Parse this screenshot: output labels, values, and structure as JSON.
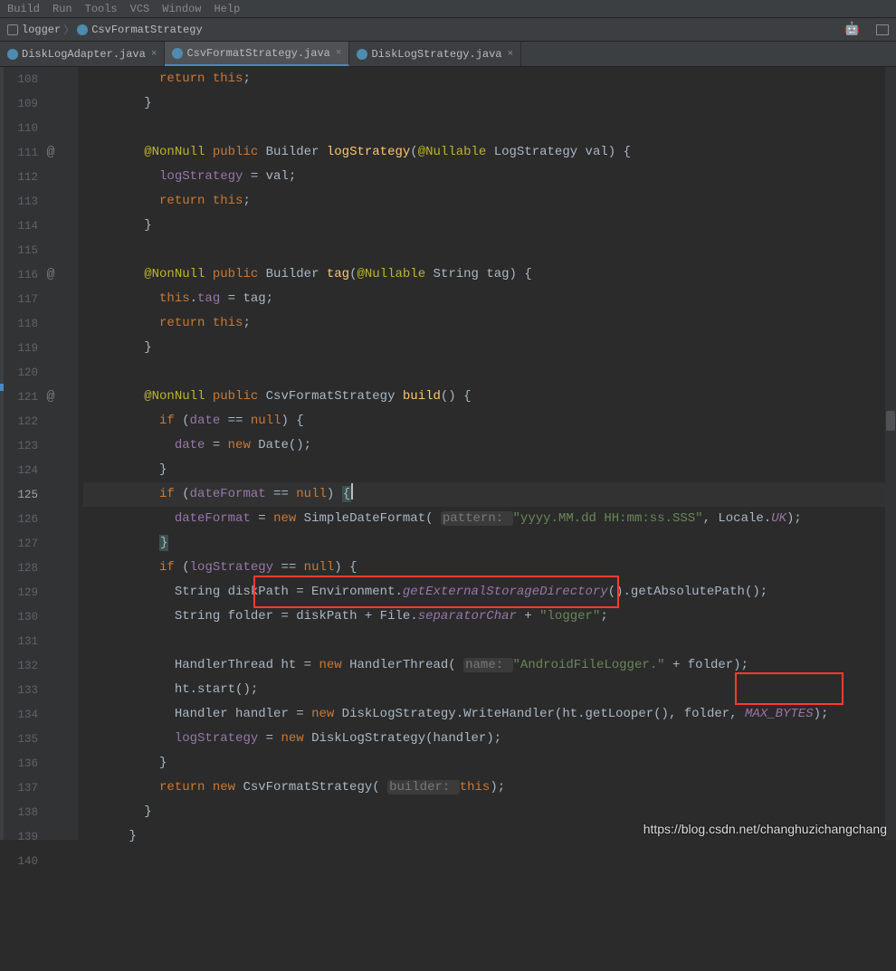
{
  "menubar": [
    "Build",
    "Run",
    "Tools",
    "VCS",
    "Window",
    "Help"
  ],
  "breadcrumb": {
    "module": "logger",
    "class": "CsvFormatStrategy"
  },
  "tabs": [
    {
      "label": "DiskLogAdapter.java",
      "active": false
    },
    {
      "label": "CsvFormatStrategy.java",
      "active": true
    },
    {
      "label": "DiskLogStrategy.java",
      "active": false
    }
  ],
  "gutter": {
    "start": 108,
    "end": 140,
    "current": 125,
    "annotation_markers": [
      111,
      116,
      121
    ]
  },
  "code": {
    "l108": {
      "indent": "          ",
      "t1": "return ",
      "t2": "this",
      "t3": ";"
    },
    "l109": {
      "indent": "        ",
      "brace": "}"
    },
    "l110": "",
    "l111": {
      "indent": "        ",
      "an": "@NonNull ",
      "kw1": "public ",
      "type": "Builder ",
      "mname": "logStrategy",
      "paren1": "(",
      "an2": "@Nullable ",
      "ptype": "LogStrategy ",
      "pname": "val",
      "paren2": ") {"
    },
    "l112": {
      "indent": "          ",
      "fld": "logStrategy",
      "rest": " = val;"
    },
    "l113": {
      "indent": "          ",
      "kw": "return ",
      "kw2": "this",
      "semi": ";"
    },
    "l114": {
      "indent": "        ",
      "brace": "}"
    },
    "l115": "",
    "l116": {
      "indent": "        ",
      "an": "@NonNull ",
      "kw1": "public ",
      "type": "Builder ",
      "mname": "tag",
      "paren1": "(",
      "an2": "@Nullable ",
      "ptype": "String ",
      "pname": "tag",
      "paren2": ") {"
    },
    "l117": {
      "indent": "          ",
      "kw": "this",
      "dot": ".",
      "fld": "tag",
      "rest": " = tag;"
    },
    "l118": {
      "indent": "          ",
      "kw": "return ",
      "kw2": "this",
      "semi": ";"
    },
    "l119": {
      "indent": "        ",
      "brace": "}"
    },
    "l120": "",
    "l121": {
      "indent": "        ",
      "an": "@NonNull ",
      "kw1": "public ",
      "type": "CsvFormatStrategy ",
      "mname": "build",
      "paren1": "()",
      "paren2": " {"
    },
    "l122": {
      "indent": "          ",
      "kw": "if ",
      "p1": "(",
      "fld": "date",
      "op": " == ",
      "kw2": "null",
      "p2": ") {"
    },
    "l123": {
      "indent": "            ",
      "fld": "date",
      "eq": " = ",
      "kw": "new ",
      "type": "Date",
      "rest": "();"
    },
    "l124": {
      "indent": "          ",
      "brace": "}"
    },
    "l125": {
      "indent": "          ",
      "kw": "if ",
      "p1": "(",
      "fld": "dateFormat",
      "op": " == ",
      "kw2": "null",
      "p2": ") ",
      "brace": "{"
    },
    "l126": {
      "indent": "            ",
      "fld": "dateFormat",
      "eq": " = ",
      "kw": "new ",
      "type": "SimpleDateFormat",
      "p1": "( ",
      "hint": "pattern: ",
      "str": "\"yyyy.MM.dd HH:mm:ss.SSS\"",
      "comma": ", Locale.",
      "fld2": "UK",
      "p2": ");"
    },
    "l127": {
      "indent": "          ",
      "brace": "}"
    },
    "l128": {
      "indent": "          ",
      "kw": "if ",
      "p1": "(",
      "fld": "logStrategy",
      "op": " == ",
      "kw2": "null",
      "p2": ") {"
    },
    "l129": {
      "indent": "            ",
      "type": "String ",
      "var": "diskPath = Environment.",
      "mname": "getExternalStorageDirectory",
      "rest": "().getAbsolutePath();"
    },
    "l130": {
      "indent": "            ",
      "type": "String ",
      "var": "folder = diskPath + File.",
      "fld": "separatorChar",
      "plus": " + ",
      "str": "\"logger\"",
      "semi": ";"
    },
    "l131": "",
    "l132": {
      "indent": "            ",
      "type": "HandlerThread ",
      "var": "ht = ",
      "kw": "new ",
      "type2": "HandlerThread",
      "p1": "( ",
      "hint": "name: ",
      "str": "\"AndroidFileLogger.\"",
      "rest": " + folder);"
    },
    "l133": {
      "indent": "            ",
      "txt": "ht.start();"
    },
    "l134": {
      "indent": "            ",
      "type": "Handler ",
      "var": "handler = ",
      "kw": "new ",
      "type2": "DiskLogStrategy.WriteHandler",
      "p1": "(ht.getLooper(), folder, ",
      "fld": "MAX_BYTES",
      "p2": ");"
    },
    "l135": {
      "indent": "            ",
      "fld": "logStrategy",
      "eq": " = ",
      "kw": "new ",
      "type": "DiskLogStrategy",
      "rest": "(handler);"
    },
    "l136": {
      "indent": "          ",
      "brace": "}"
    },
    "l137": {
      "indent": "          ",
      "kw": "return new ",
      "type": "CsvFormatStrategy",
      "p1": "( ",
      "hint": "builder: ",
      "kw2": "this",
      "p2": ");"
    },
    "l138": {
      "indent": "        ",
      "brace": "}"
    },
    "l139": {
      "indent": "      ",
      "brace": "}"
    }
  },
  "watermark": "https://blog.csdn.net/changhuzichangchang"
}
